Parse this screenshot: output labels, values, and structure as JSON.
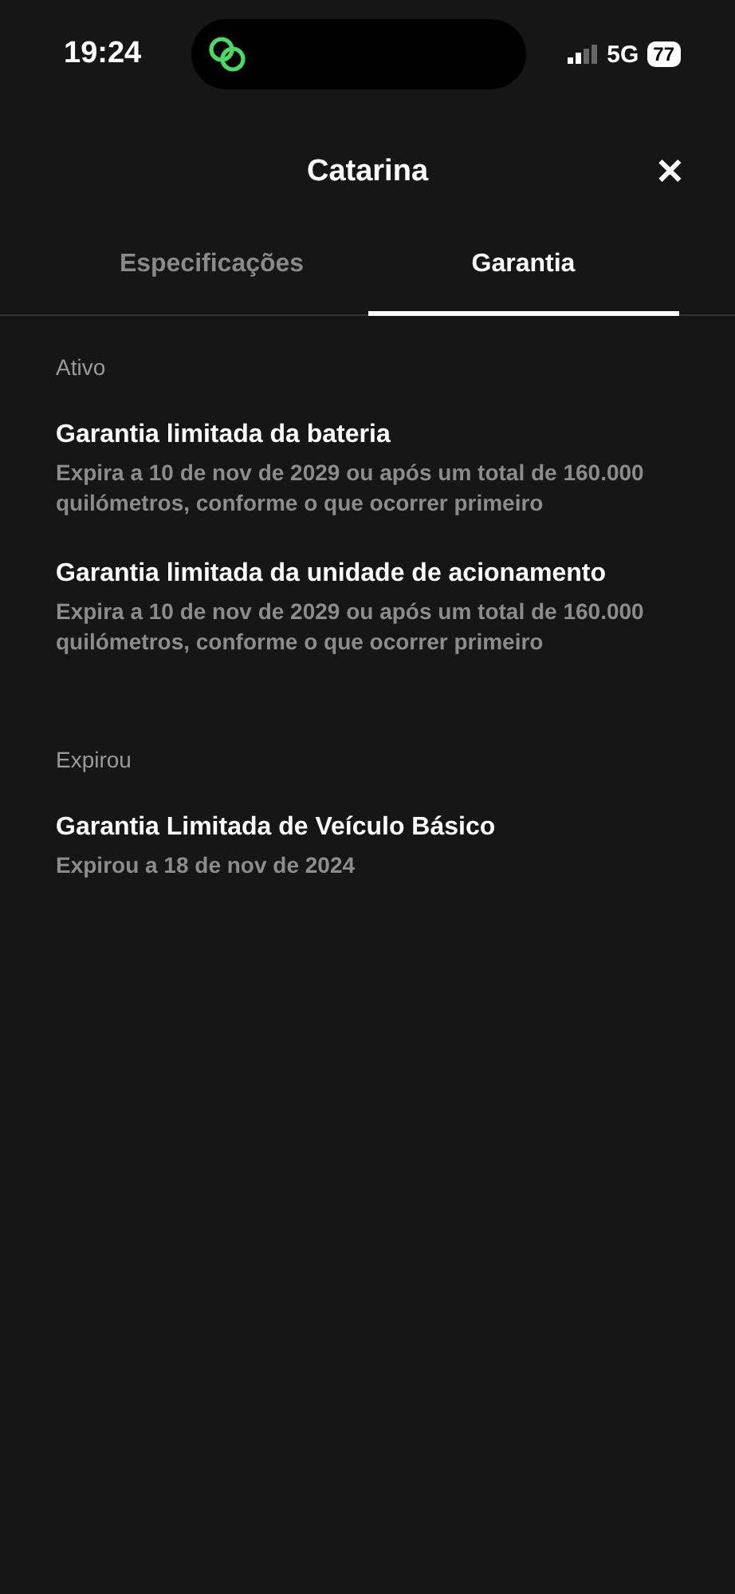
{
  "status_bar": {
    "time": "19:24",
    "network": "5G",
    "battery": "77"
  },
  "header": {
    "title": "Catarina",
    "close": "✕"
  },
  "tabs": [
    {
      "label": "Especificações",
      "selected": false
    },
    {
      "label": "Garantia",
      "selected": true
    }
  ],
  "sections": [
    {
      "heading": "Ativo",
      "items": [
        {
          "title": "Garantia limitada da bateria",
          "detail": "Expira a 10 de nov de 2029 ou após um total de 160.000 quilómetros, conforme o que ocorrer primeiro"
        },
        {
          "title": "Garantia limitada da unidade de acionamento",
          "detail": "Expira a 10 de nov de 2029 ou após um total de 160.000 quilómetros, conforme o que ocorrer primeiro"
        }
      ]
    },
    {
      "heading": "Expirou",
      "items": [
        {
          "title": "Garantia Limitada de Veículo Básico",
          "detail": "Expirou a 18 de nov de 2024"
        }
      ]
    }
  ]
}
